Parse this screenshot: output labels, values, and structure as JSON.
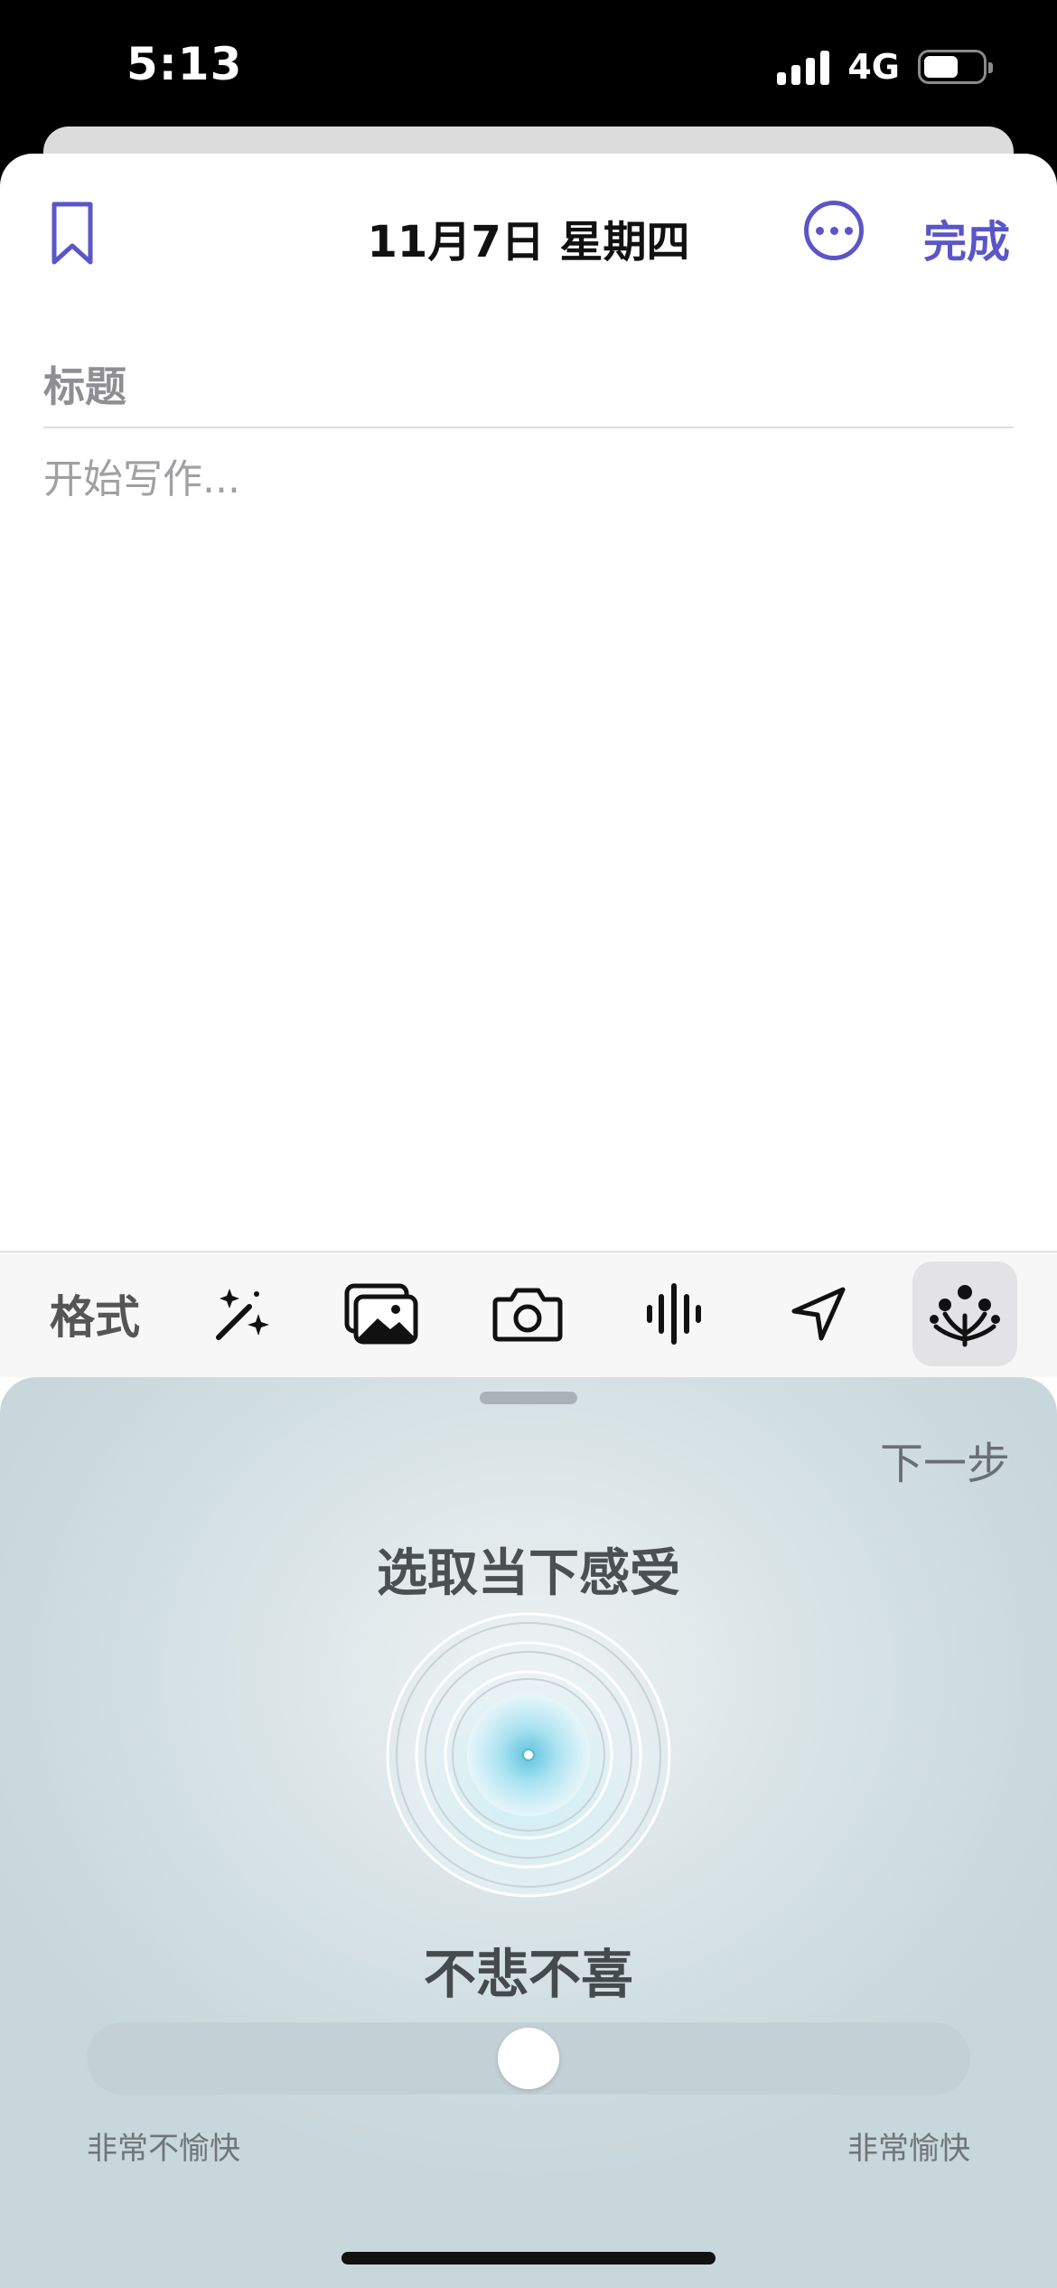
{
  "status_bar": {
    "time": "5:13",
    "network": "4G",
    "battery_level": 0.6
  },
  "nav": {
    "date_title": "11月7日 星期四",
    "done_label": "完成"
  },
  "editor": {
    "title_placeholder": "标题",
    "body_placeholder": "开始写作..."
  },
  "toolbar": {
    "format_label": "格式",
    "icons": [
      "magic-wand-icon",
      "photo-library-icon",
      "camera-icon",
      "waveform-icon",
      "location-arrow-icon",
      "mood-sparkle-icon"
    ],
    "active": "mood-sparkle-icon"
  },
  "mood": {
    "next_label": "下一步",
    "heading": "选取当下感受",
    "current_label": "不悲不喜",
    "slider": {
      "value": 0.5,
      "min_label": "非常不愉快",
      "max_label": "非常愉快"
    }
  },
  "colors": {
    "accent": "#5a55c8",
    "panel_bg": "#d6e2e5",
    "orb": "#7fd0e6"
  }
}
